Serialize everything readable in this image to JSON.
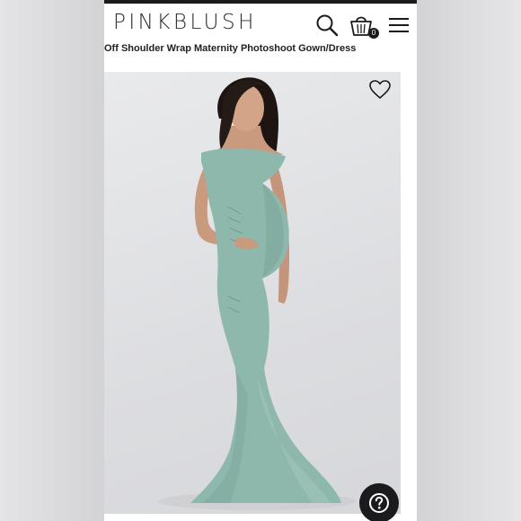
{
  "header": {
    "brand": "PINKBLUSH",
    "cart_count": "0"
  },
  "product": {
    "title": "Off Shoulder Wrap Maternity Photoshoot Gown/Dress"
  },
  "icons": {
    "search": "search-icon",
    "cart": "shopping-bag-icon",
    "menu": "hamburger-menu-icon",
    "wishlist": "heart-icon",
    "help": "question-mark-icon"
  },
  "colors": {
    "dress": "#8fb8ad",
    "brand_text": "#2b2b2b",
    "help_button": "#1b1b1d"
  }
}
